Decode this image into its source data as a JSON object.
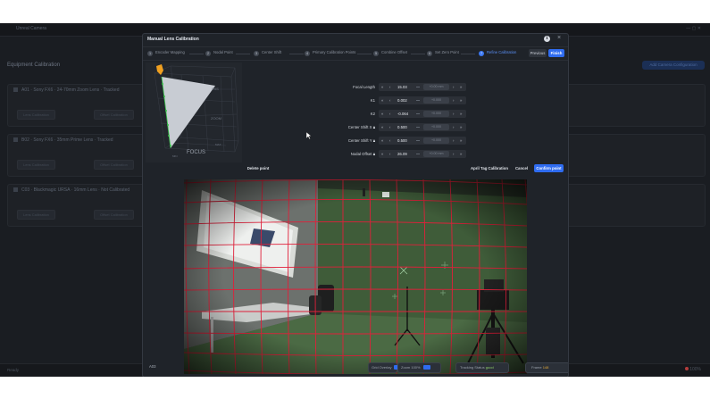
{
  "app": {
    "title": "Unreal Camera",
    "topbar_right": "— ▢ ✕",
    "page_heading": "Equipment Calibration",
    "add_button": "Add Camera Configuration",
    "cards": [
      {
        "title": "A01 · Sony FX6 · 24-70mm Zoom Lens · Tracked",
        "pills": [
          "Lens Calibration",
          "Offset Calibration"
        ]
      },
      {
        "title": "B02 · Sony FX6 · 35mm Prime Lens · Tracked",
        "pills": [
          "Lens Calibration",
          "Offset Calibration"
        ]
      },
      {
        "title": "C03 · Blackmagic URSA · 16mm Lens · Not Calibrated",
        "pills": [
          "Lens Calibration",
          "Offset Calibration"
        ]
      }
    ],
    "footer_left": "Ready",
    "footer_right": "100%"
  },
  "modal": {
    "title": "Manual Lens Calibration",
    "info_icon": "info-icon",
    "close_icon": "close-icon",
    "steps": [
      {
        "num": "1",
        "label": "Encoder Mapping",
        "active": false
      },
      {
        "num": "2",
        "label": "Nodal Point",
        "active": false
      },
      {
        "num": "3",
        "label": "Center Shift",
        "active": false
      },
      {
        "num": "4",
        "label": "Primary Calibration Points",
        "active": false
      },
      {
        "num": "5",
        "label": "Combine Offset",
        "active": false
      },
      {
        "num": "6",
        "label": "Set Zero Point",
        "active": false
      },
      {
        "num": "7",
        "label": "Refine Calibration",
        "active": true
      }
    ],
    "previous_label": "Previous",
    "finish_label": "Finish",
    "viz": {
      "axis_focus": "FOCUS",
      "axis_iris": "IRIS",
      "axis_zoom": "ZOOM",
      "min_label": "MIN",
      "max_label": "MAX",
      "fill_color": "#c8ccd3",
      "marker_color": "#f0a020",
      "point_color": "#39c84a"
    },
    "fields": [
      {
        "label": "Focal Length",
        "value": "15.03",
        "ghost": "+0.00 mm",
        "lock": false
      },
      {
        "label": "K1",
        "value": "0.002",
        "ghost": "+0.000",
        "lock": false
      },
      {
        "label": "K2",
        "value": "-0.064",
        "ghost": "+0.000",
        "lock": false
      },
      {
        "label": "Center Shift X",
        "value": "0.500",
        "ghost": "+0.000",
        "lock": true
      },
      {
        "label": "Center Shift Y",
        "value": "0.500",
        "ghost": "+0.000",
        "lock": true
      },
      {
        "label": "Nodal Offset",
        "value": "26.09",
        "ghost": "+0.00 mm",
        "lock": true
      }
    ],
    "delete_label": "Delete point",
    "april_label": "April Tag Calibration",
    "cancel_label": "Cancel",
    "confirm_label": "Confirm point",
    "side_label": "A03",
    "status": {
      "grid_label": "Grid Overlay",
      "grid_toggle": "On",
      "zoom_label": "Zoom",
      "zoom_value": "100%",
      "tracking_label": "Tracking Status",
      "tracking_value": "good",
      "frame_label": "Frame",
      "frame_value": "148"
    },
    "accent": "#2f6cf0",
    "grid_color": "#e0203a"
  }
}
